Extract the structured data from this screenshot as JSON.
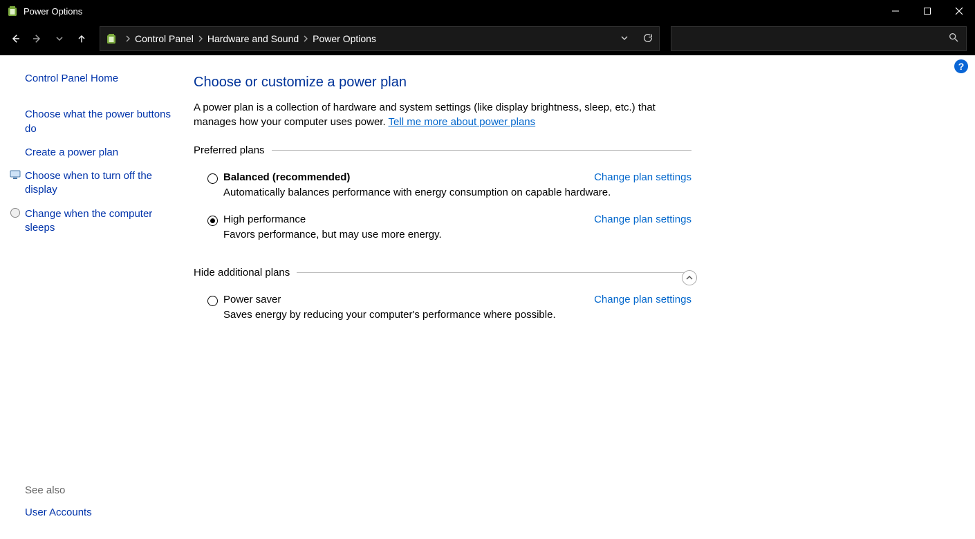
{
  "window": {
    "title": "Power Options"
  },
  "breadcrumb": {
    "seg1": "Control Panel",
    "seg2": "Hardware and Sound",
    "seg3": "Power Options"
  },
  "sidebar": {
    "home": "Control Panel Home",
    "link1": "Choose what the power buttons do",
    "link2": "Create a power plan",
    "link3": "Choose when to turn off the display",
    "link4": "Change when the computer sleeps",
    "see_also_label": "See also",
    "user_accounts": "User Accounts"
  },
  "main": {
    "heading": "Choose or customize a power plan",
    "desc_prefix": "A power plan is a collection of hardware and system settings (like display brightness, sleep, etc.) that manages how your computer uses power. ",
    "desc_link": "Tell me more about power plans",
    "preferred_legend": "Preferred plans",
    "hide_legend": "Hide additional plans",
    "change_link": "Change plan settings",
    "plans": {
      "balanced": {
        "name": "Balanced (recommended)",
        "desc": "Automatically balances performance with energy consumption on capable hardware."
      },
      "high": {
        "name": "High performance",
        "desc": "Favors performance, but may use more energy."
      },
      "saver": {
        "name": "Power saver",
        "desc": "Saves energy by reducing your computer's performance where possible."
      }
    }
  },
  "help_icon": "?"
}
